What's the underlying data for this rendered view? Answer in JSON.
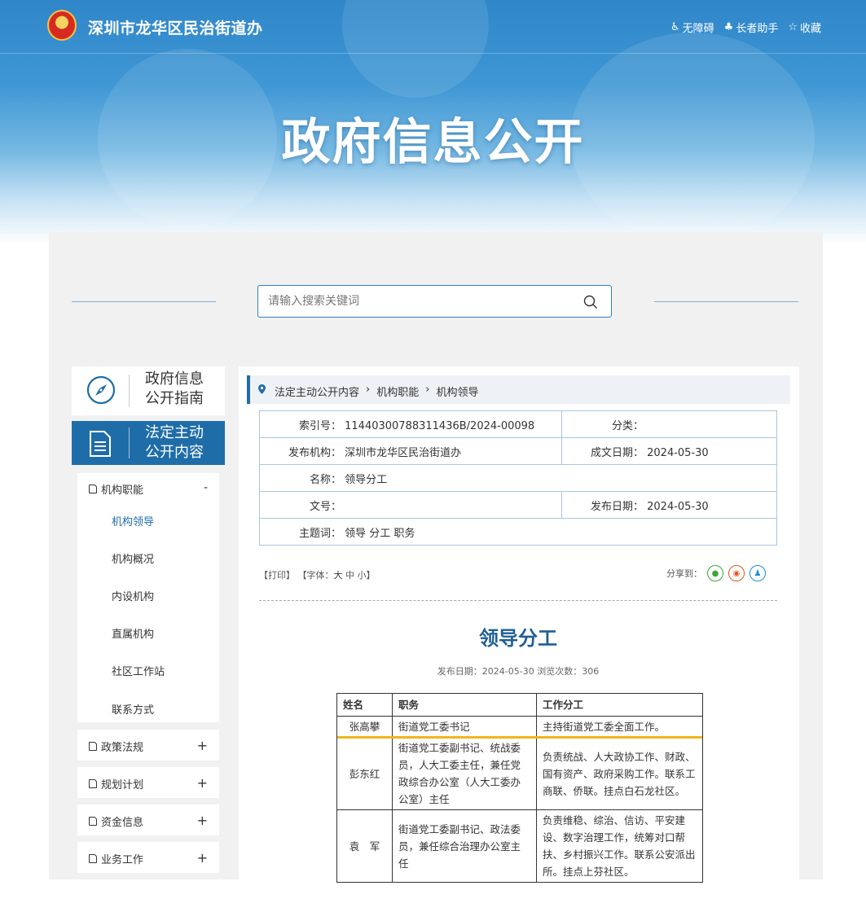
{
  "header": {
    "site_title": "深圳市龙华区民治街道办",
    "links": [
      {
        "icon": "accessibility-icon",
        "label": "无障碍"
      },
      {
        "icon": "elder-helper-icon",
        "label": "长者助手"
      },
      {
        "icon": "star-icon",
        "label": "收藏"
      }
    ],
    "banner_title": "政府信息公开"
  },
  "search": {
    "placeholder": "请输入搜索关键词"
  },
  "sidebar": {
    "guide": "政府信息公开指南",
    "guide_lines": [
      "政府信息",
      "公开指南"
    ],
    "active_lines": [
      "法定主动",
      "公开内容"
    ],
    "menu": {
      "title": "机构职能",
      "toggle": "-",
      "items": [
        "机构领导",
        "机构概况",
        "内设机构",
        "直属机构",
        "社区工作站",
        "联系方式"
      ]
    },
    "categories": [
      {
        "label": "政策法规",
        "toggle": "+"
      },
      {
        "label": "规划计划",
        "toggle": "+"
      },
      {
        "label": "资金信息",
        "toggle": "+"
      },
      {
        "label": "业务工作",
        "toggle": "+"
      }
    ]
  },
  "breadcrumb": [
    "法定主动公开内容",
    "机构职能",
    "机构领导"
  ],
  "meta": {
    "index_label": "索引号：",
    "index_value": "11440300788311436B/2024-00098",
    "category_label": "分类：",
    "category_value": "",
    "publisher_label": "发布机构：",
    "publisher_value": "深圳市龙华区民治街道办",
    "date_written_label": "成文日期：",
    "date_written_value": "2024-05-30",
    "name_label": "名称：",
    "name_value": "领导分工",
    "docno_label": "文号：",
    "docno_value": "",
    "publish_date_label": "发布日期：",
    "publish_date_value": "2024-05-30",
    "keywords_label": "主题词：",
    "keywords_value": "领导 分工 职务"
  },
  "tools": {
    "print": "【打印】",
    "font_prefix": "【字体：",
    "font_big": "大",
    "font_mid": "中",
    "font_small": "小",
    "font_suffix": "】",
    "share_label": "分享到："
  },
  "article": {
    "title": "领导分工",
    "publish_info": "发布日期：2024-05-30  浏览次数：306",
    "table_headers": [
      "姓名",
      "职务",
      "工作分工"
    ],
    "rows": [
      {
        "name": "张高攀",
        "position": "街道党工委书记",
        "duty": "主持街道党工委全面工作。"
      },
      {
        "name": "彭东红",
        "position": "街道党工委副书记、统战委员，人大工委主任，兼任党政综合办公室（人大工委办公室）主任",
        "duty": "负责统战、人大政协工作、财政、国有资产、政府采购工作。联系工商联、侨联。挂点白石龙社区。"
      },
      {
        "name": "袁　军",
        "position": "街道党工委副书记、政法委员，兼任综合治理办公室主任",
        "duty": "负责维稳、综治、信访、平安建设、数字治理工作，统筹对口帮扶、乡村振兴工作。联系公安派出所。挂点上芬社区。"
      }
    ]
  },
  "colors": {
    "primary": "#1f6da8",
    "highlight": "#f0b41c",
    "wechat": "#3aa63a",
    "weibo": "#e2561f",
    "qq": "#1e8fd6"
  }
}
